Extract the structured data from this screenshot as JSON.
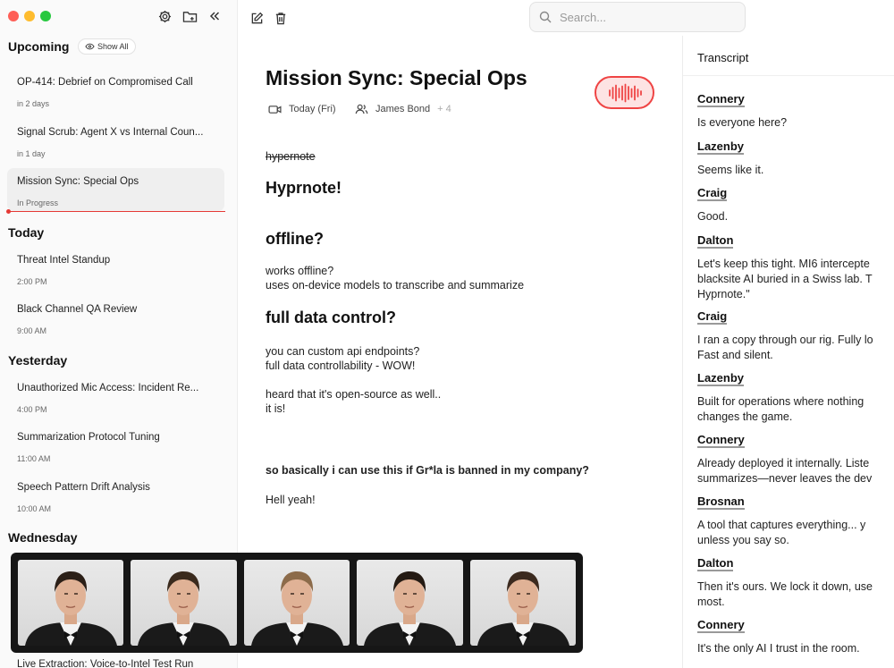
{
  "sidebar": {
    "upcoming_heading": "Upcoming",
    "show_all_label": "Show All",
    "today_heading": "Today",
    "yesterday_heading": "Yesterday",
    "wednesday_heading": "Wednesday",
    "upcoming": [
      {
        "title": "OP-414: Debrief on Compromised Call",
        "sub": "in 2 days"
      },
      {
        "title": "Signal Scrub: Agent X vs Internal Coun...",
        "sub": "in 1 day"
      },
      {
        "title": "Mission Sync: Special Ops",
        "sub": "In Progress"
      }
    ],
    "today": [
      {
        "title": "Threat Intel Standup",
        "sub": "2:00 PM"
      },
      {
        "title": "Black Channel QA Review",
        "sub": "9:00 AM"
      }
    ],
    "yesterday": [
      {
        "title": "Unauthorized Mic Access: Incident Re...",
        "sub": "4:00 PM"
      },
      {
        "title": "Summarization Protocol Tuning",
        "sub": "11:00 AM"
      },
      {
        "title": "Speech Pattern Drift Analysis",
        "sub": "10:00 AM"
      }
    ],
    "wednesday": [
      {
        "title": "Live Extraction: Voice-to-Intel Test Run"
      }
    ]
  },
  "search": {
    "placeholder": "Search..."
  },
  "note": {
    "title": "Mission Sync: Special Ops",
    "date": "Today (Fri)",
    "participant": "James Bond",
    "extra_participants": "+ 4",
    "strike_text": "hypernote",
    "heading1": "Hyprnote!",
    "heading2": "offline?",
    "p2_line1": "works offline?",
    "p2_line2": "uses on-device models to transcribe and summarize",
    "heading3": "full data control?",
    "p3_line1": "you can custom api endpoints?",
    "p3_line2": "full data controllability - WOW!",
    "p3_line3": "heard that it's open-source as well..",
    "p3_line4": "it is!",
    "question": "so basically i can use this if Gr*la is banned in my company?",
    "answer": "Hell yeah!"
  },
  "transcript": {
    "title": "Transcript",
    "entries": [
      {
        "speaker": "Connery",
        "lines": [
          "Is everyone here?"
        ]
      },
      {
        "speaker": "Lazenby",
        "lines": [
          "Seems like it."
        ]
      },
      {
        "speaker": "Craig",
        "lines": [
          "Good."
        ]
      },
      {
        "speaker": "Dalton",
        "lines": [
          "Let's keep this tight. MI6 intercepte",
          "blacksite AI buried in a Swiss lab. T",
          "Hyprnote.\""
        ]
      },
      {
        "speaker": "Craig",
        "lines": [
          "I ran a copy through our rig. Fully lo",
          "Fast and silent."
        ]
      },
      {
        "speaker": "Lazenby",
        "lines": [
          "Built for operations where nothing",
          "changes the game."
        ]
      },
      {
        "speaker": "Connery",
        "lines": [
          "Already deployed it internally. Liste",
          "summarizes—never leaves the dev"
        ]
      },
      {
        "speaker": "Brosnan",
        "lines": [
          "A tool that captures everything... y",
          "unless you say so."
        ]
      },
      {
        "speaker": "Dalton",
        "lines": [
          "Then it's ours. We lock it down, use",
          "most."
        ]
      },
      {
        "speaker": "Connery",
        "lines": [
          "It's the only AI I trust in the room."
        ]
      }
    ]
  },
  "photos": [
    {
      "name": "connery"
    },
    {
      "name": "lazenby"
    },
    {
      "name": "craig"
    },
    {
      "name": "brosnan"
    },
    {
      "name": "dalton"
    }
  ],
  "colors": {
    "accent_red": "#ef4444",
    "record_bg": "#fde3e3",
    "sidebar_bg": "#fafafa"
  }
}
